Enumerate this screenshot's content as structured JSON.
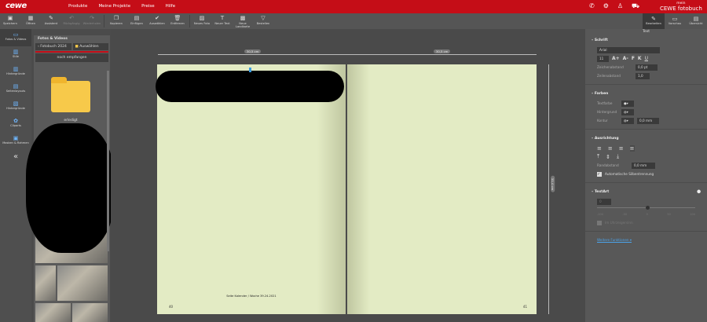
{
  "header": {
    "logo": "cewe",
    "nav": [
      "Produkte",
      "Meine Projekte",
      "Preise",
      "Hilfe"
    ],
    "brand_top": "mein",
    "brand": "CEWE fotobuch",
    "icons": [
      "phone-icon",
      "gear-icon",
      "user-icon",
      "cart-icon"
    ]
  },
  "toolbar": {
    "left": [
      {
        "label": "Speichern",
        "icon": "▣"
      },
      {
        "label": "Öffnen",
        "icon": "▦"
      },
      {
        "label": "Assistent",
        "icon": "✎"
      }
    ],
    "mid": [
      {
        "label": "Rückgängig",
        "icon": "↶"
      },
      {
        "label": "Wiederholen",
        "icon": "↷"
      }
    ],
    "edit": [
      {
        "label": "Kopieren",
        "icon": "❐"
      },
      {
        "label": "Einfügen",
        "icon": "▤"
      },
      {
        "label": "Auswählen",
        "icon": "✔"
      },
      {
        "label": "Entfernen",
        "icon": "🗑"
      }
    ],
    "insert": [
      {
        "label": "Neues Foto",
        "icon": "▨"
      },
      {
        "label": "Neuer Text",
        "icon": "T"
      },
      {
        "label": "Neue Landkarte",
        "icon": "▩"
      },
      {
        "label": "Bestellen",
        "icon": "▽"
      }
    ],
    "views": [
      {
        "label": "Bearbeiten",
        "icon": "✎"
      },
      {
        "label": "Vorschau",
        "icon": "▭"
      },
      {
        "label": "Übersicht",
        "icon": "▤"
      }
    ]
  },
  "sidebar": {
    "items": [
      "Fotos & Videos",
      "Stile",
      "Hintergründe",
      "Seitenlayouts",
      "Hintergründe",
      "Cliparts",
      "Masken & Rahmen"
    ],
    "collapse": "«"
  },
  "photos_panel": {
    "title": "Fotos & Videos",
    "back": "‹ Fotobuch 2024",
    "select": "Auswählen",
    "notice": "noch empfangen",
    "folder_label": "erledigt"
  },
  "book": {
    "ruler_left": "30,5 cm",
    "ruler_right": "30,5 cm",
    "ruler_vertical": "31,4 cm",
    "footer_text": "Seite Kalender / Woche 39.24.2021",
    "page_left": "40",
    "page_right": "41",
    "page_color": "#e3ebc4"
  },
  "props": {
    "title": "Text",
    "font": {
      "section": "Schrift",
      "family": "Arial",
      "size": "11",
      "bold": "F",
      "italic": "K",
      "underline": "U",
      "letter_label": "Zeichenabstand",
      "letter_value": "0,0 pt",
      "line_label": "Zeilenabstand",
      "line_value": "1,0"
    },
    "colors": {
      "section": "Farben",
      "text_label": "Textfarbe",
      "bg_label": "Hintergrund",
      "outline_label": "Kontur",
      "outline_value": "0,0 mm"
    },
    "align": {
      "section": "Ausrichtung",
      "margin_label": "Randabstand",
      "margin_value": "0,0 mm",
      "hyphen_label": "Automatische Silbentrennung",
      "hyphen_checked": true
    },
    "textart": {
      "section": "TextArt",
      "value": "0",
      "ticks": [
        "-100",
        "-50",
        "0",
        "50",
        "100"
      ],
      "checkbox_label": "Im Uhrzeigersinn"
    },
    "more": "Weitere Funktionen ▾"
  }
}
